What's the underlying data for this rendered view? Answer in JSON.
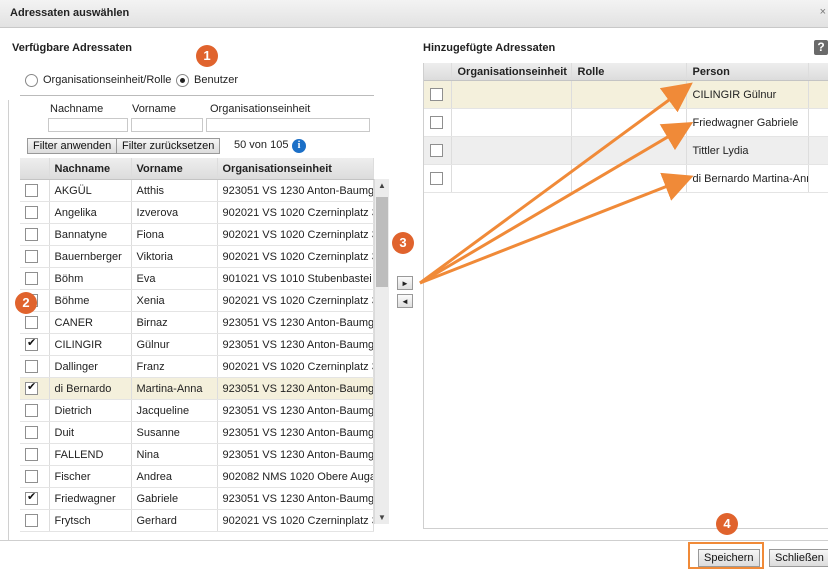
{
  "window": {
    "title": "Adressaten auswählen",
    "close_glyph": "×"
  },
  "left": {
    "title": "Verfügbare Adressaten",
    "radios": [
      {
        "label": "Organisationseinheit/Rolle",
        "selected": false
      },
      {
        "label": "Benutzer",
        "selected": true
      }
    ],
    "filter_labels": [
      "Nachname",
      "Vorname",
      "Organisationseinheit"
    ],
    "filter_values": [
      "",
      "",
      ""
    ],
    "apply_label": "Filter anwenden",
    "reset_label": "Filter zurücksetzen",
    "count_text": "50 von 105",
    "info_glyph": "i",
    "columns": [
      "",
      "Nachname",
      "Vorname",
      "Organisationseinheit"
    ],
    "rows": [
      {
        "checked": false,
        "lastname": "AKGÜL",
        "firstname": "Atthis",
        "org": "923051 VS 1230 Anton-Baumg"
      },
      {
        "checked": false,
        "lastname": "Angelika",
        "firstname": "Izverova",
        "org": "902021 VS 1020 Czerninplatz 3"
      },
      {
        "checked": false,
        "lastname": "Bannatyne",
        "firstname": "Fiona",
        "org": "902021 VS 1020 Czerninplatz 3"
      },
      {
        "checked": false,
        "lastname": "Bauernberger",
        "firstname": "Viktoria",
        "org": "902021 VS 1020 Czerninplatz 3"
      },
      {
        "checked": false,
        "lastname": "Böhm",
        "firstname": "Eva",
        "org": "901021 VS 1010 Stubenbastei"
      },
      {
        "checked": false,
        "lastname": "Böhme",
        "firstname": "Xenia",
        "org": "902021 VS 1020 Czerninplatz 3"
      },
      {
        "checked": false,
        "lastname": "CANER",
        "firstname": "Birnaz",
        "org": "923051 VS 1230 Anton-Baumg"
      },
      {
        "checked": true,
        "lastname": "CILINGIR",
        "firstname": "Gülnur",
        "org": "923051 VS 1230 Anton-Baumg"
      },
      {
        "checked": false,
        "lastname": "Dallinger",
        "firstname": "Franz",
        "org": "902021 VS 1020 Czerninplatz 3"
      },
      {
        "checked": true,
        "lastname": "di Bernardo",
        "firstname": "Martina-Anna",
        "org": "923051 VS 1230 Anton-Baumg",
        "highlight": true
      },
      {
        "checked": false,
        "lastname": "Dietrich",
        "firstname": "Jacqueline",
        "org": "923051 VS 1230 Anton-Baumg"
      },
      {
        "checked": false,
        "lastname": "Duit",
        "firstname": "Susanne",
        "org": "923051 VS 1230 Anton-Baumg"
      },
      {
        "checked": false,
        "lastname": "FALLEND",
        "firstname": "Nina",
        "org": "923051 VS 1230 Anton-Baumg"
      },
      {
        "checked": false,
        "lastname": "Fischer",
        "firstname": "Andrea",
        "org": "902082 NMS 1020 Obere Auga"
      },
      {
        "checked": true,
        "lastname": "Friedwagner",
        "firstname": "Gabriele",
        "org": "923051 VS 1230 Anton-Baumg"
      },
      {
        "checked": false,
        "lastname": "Frytsch",
        "firstname": "Gerhard",
        "org": "902021 VS 1020 Czerninplatz 3"
      }
    ],
    "scroll_up": "▲",
    "scroll_down": "▼"
  },
  "move": {
    "add_glyph": "►",
    "remove_glyph": "◄"
  },
  "right": {
    "title": "Hinzugefügte Adressaten",
    "help_glyph": "?",
    "columns": [
      "",
      "Organisationseinheit",
      "Rolle",
      "Person"
    ],
    "rows": [
      {
        "checked": false,
        "org": "",
        "role": "",
        "person": "CILINGIR Gülnur"
      },
      {
        "checked": false,
        "org": "",
        "role": "",
        "person": "Friedwagner Gabriele"
      },
      {
        "checked": false,
        "org": "",
        "role": "",
        "person": "Tittler Lydia"
      },
      {
        "checked": false,
        "org": "",
        "role": "",
        "person": "di Bernardo Martina-Anna"
      }
    ]
  },
  "footer": {
    "save_label": "Speichern",
    "close_label": "Schließen"
  },
  "badges": [
    "1",
    "2",
    "3",
    "4"
  ],
  "colors": {
    "annotation": "#e0632d",
    "arrow": "#f08a38",
    "highlight_row": "#f4f0dc",
    "info": "#1b6fc7"
  }
}
